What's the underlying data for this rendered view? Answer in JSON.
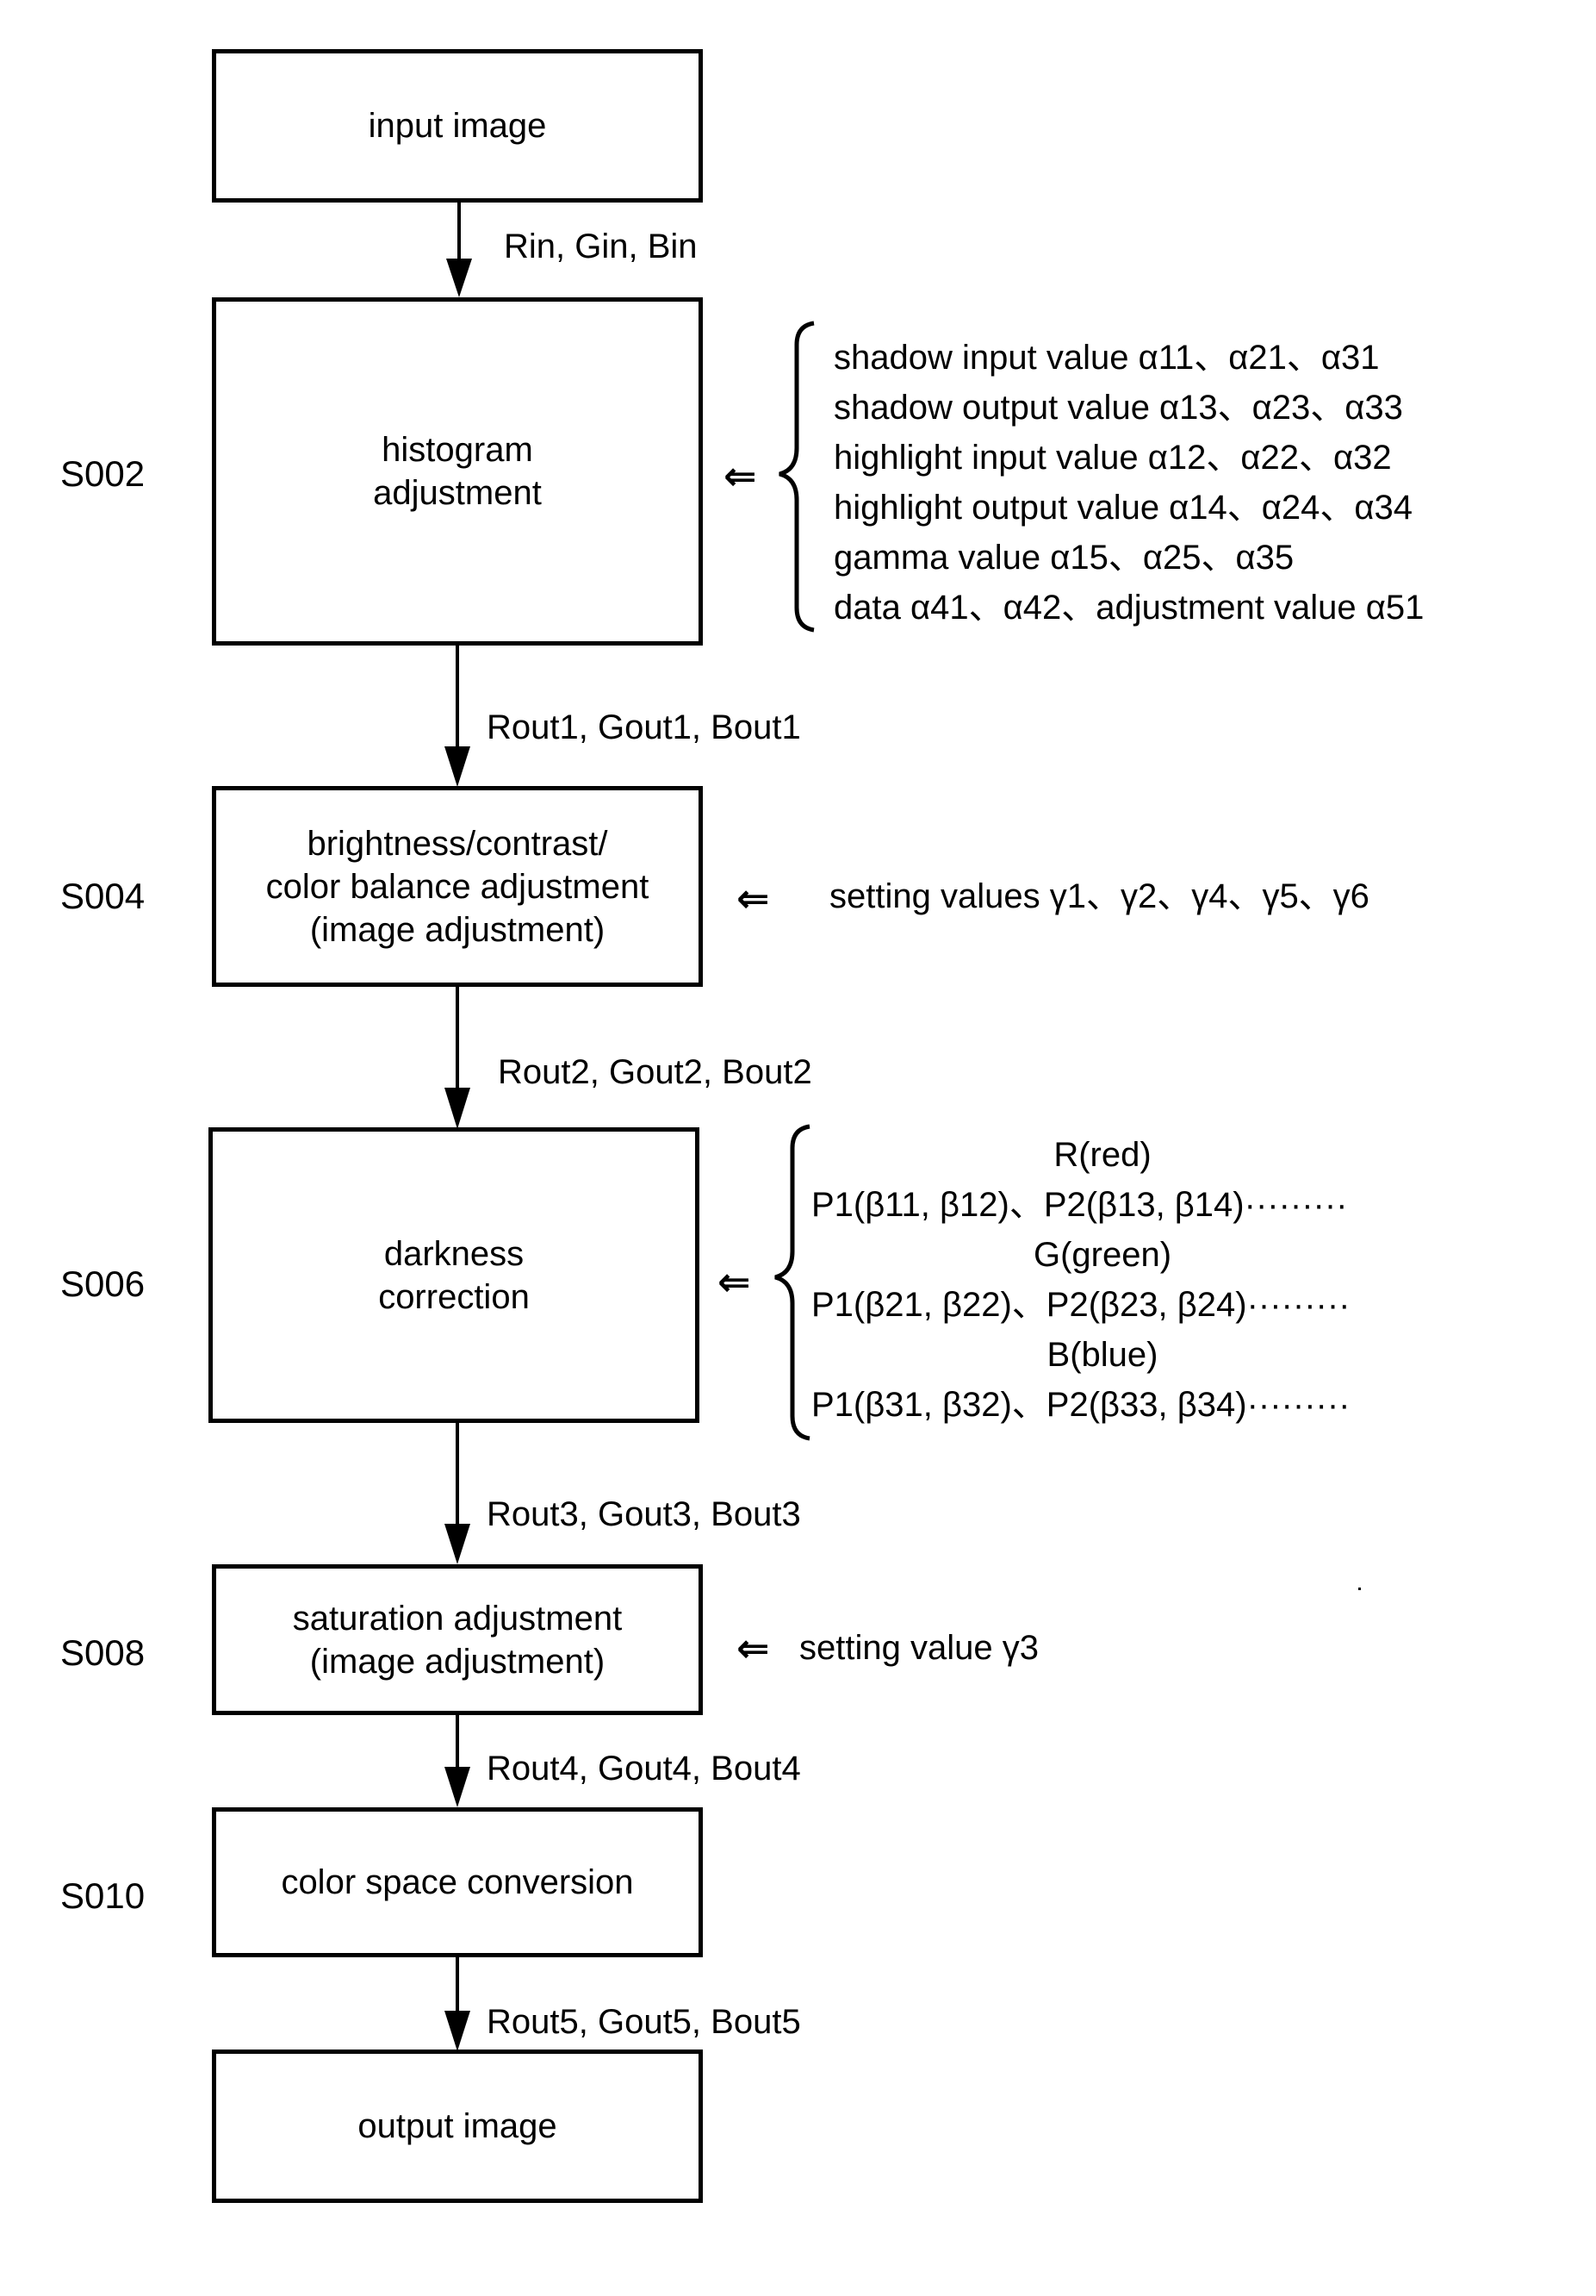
{
  "diagram": {
    "type": "flowchart",
    "direction": "top-to-bottom",
    "nodes": {
      "input": {
        "label": "input image"
      },
      "s002": {
        "step": "S002",
        "label": "histogram\nadjustment"
      },
      "s004": {
        "step": "S004",
        "label": "brightness/contrast/\ncolor balance adjustment\n(image adjustment)"
      },
      "s006": {
        "step": "S006",
        "label": "darkness\ncorrection"
      },
      "s008": {
        "step": "S008",
        "label": "saturation adjustment\n(image adjustment)"
      },
      "s010": {
        "step": "S010",
        "label": "color space conversion"
      },
      "output": {
        "label": "output image"
      }
    },
    "edges": {
      "e0": {
        "from": "input image",
        "to": "S002",
        "label": "Rin, Gin, Bin"
      },
      "e1": {
        "from": "S002",
        "to": "S004",
        "label": "Rout1, Gout1, Bout1"
      },
      "e2": {
        "from": "S004",
        "to": "S006",
        "label": "Rout2, Gout2, Bout2"
      },
      "e3": {
        "from": "S006",
        "to": "S008",
        "label": "Rout3, Gout3, Bout3"
      },
      "e4": {
        "from": "S008",
        "to": "S010",
        "label": "Rout4, Gout4, Bout4"
      },
      "e5": {
        "from": "S010",
        "to": "output image",
        "label": "Rout5, Gout5, Bout5"
      }
    },
    "inputs": {
      "arrow_symbol": "⇐",
      "s002_params": [
        "shadow input value α11、α21、α31",
        "shadow output value α13、α23、α33",
        "highlight input value  α12、α22、α32",
        "highlight output value  α14、α24、α34",
        "gamma value α15、α25、α35",
        "data  α41、α42、adjustment value α51"
      ],
      "s004_params": "setting values γ1、γ2、γ4、γ5、γ6",
      "s006_params": {
        "red_header": "R(red)",
        "red_points": "P1(β11,  β12)、P2(β13,  β14)·········",
        "green_header": "G(green)",
        "green_points": "P1(β21,  β22)、P2(β23,  β24)·········",
        "blue_header": "B(blue)",
        "blue_points": "P1(β31,  β32)、P2(β33,  β34)·········"
      },
      "s008_params": "setting value γ3"
    }
  }
}
